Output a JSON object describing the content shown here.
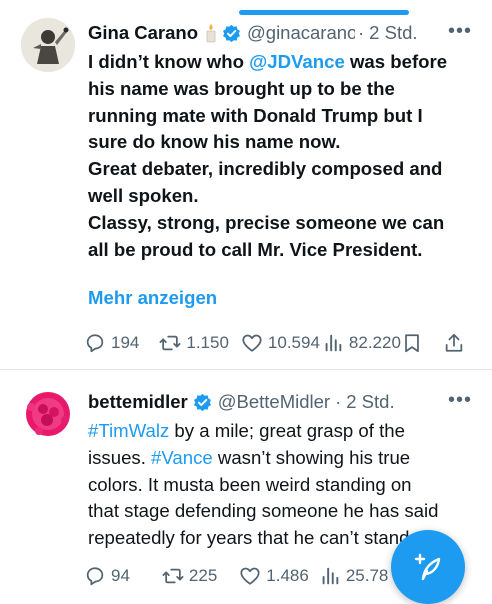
{
  "tweets": [
    {
      "author_name": "Gina Carano",
      "handle": "@ginacarano",
      "separator": "·",
      "time": "2 Std.",
      "body_lines": [
        {
          "parts": [
            {
              "t": "I didn’t know who "
            },
            {
              "t": "@JDVance",
              "link": true
            },
            {
              "t": " was before"
            }
          ]
        },
        {
          "parts": [
            {
              "t": "his name was brought up to be the"
            }
          ]
        },
        {
          "parts": [
            {
              "t": "running mate with Donald Trump but I"
            }
          ]
        },
        {
          "parts": [
            {
              "t": "sure do know his name now."
            }
          ]
        },
        {
          "parts": [
            {
              "t": " "
            }
          ]
        },
        {
          "parts": [
            {
              "t": "Great debater, incredibly composed and"
            }
          ]
        },
        {
          "parts": [
            {
              "t": "well spoken."
            }
          ]
        },
        {
          "parts": [
            {
              "t": "Classy, strong, precise someone we can"
            }
          ]
        },
        {
          "parts": [
            {
              "t": "all be proud to call Mr. Vice President."
            }
          ]
        }
      ],
      "show_more": "Mehr anzeigen",
      "replies": "194",
      "retweets": "1.150",
      "likes": "10.594",
      "views": "82.220"
    },
    {
      "author_name": "bettemidler",
      "handle": "@BetteMidler",
      "separator": "·",
      "time": "2 Std.",
      "body_lines": [
        {
          "parts": [
            {
              "t": "#TimWalz",
              "link": true
            },
            {
              "t": " by a mile; great grasp of the"
            }
          ]
        },
        {
          "parts": [
            {
              "t": "issues.  "
            },
            {
              "t": "#Vance",
              "link": true
            },
            {
              "t": " wasn’t showing his true"
            }
          ]
        },
        {
          "parts": [
            {
              "t": "colors.  It musta been weird standing on"
            }
          ]
        },
        {
          "parts": [
            {
              "t": "that stage defending someone he has said"
            }
          ]
        },
        {
          "parts": [
            {
              "t": "repeatedly for years that he can’t stand"
            }
          ]
        }
      ],
      "replies": "94",
      "retweets": "225",
      "likes": "1.486",
      "views": "25.78"
    }
  ],
  "colors": {
    "accent": "#1d9bf0",
    "text": "#0f1419",
    "secondary": "#536471",
    "verified": "#1d9bf0"
  },
  "icons": {
    "reply": "reply-icon",
    "retweet": "retweet-icon",
    "like": "like-icon",
    "views": "views-icon",
    "bookmark": "bookmark-icon",
    "share": "share-icon",
    "compose": "compose-icon"
  }
}
